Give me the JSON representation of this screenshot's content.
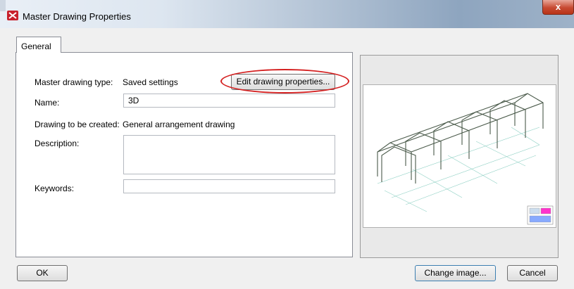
{
  "window": {
    "title": "Master Drawing Properties",
    "close_glyph": "x",
    "icon": "tekla-app-icon"
  },
  "tabs": [
    {
      "label": "General",
      "active": true
    }
  ],
  "form": {
    "master_type_label": "Master drawing type:",
    "master_type_value": "Saved settings",
    "edit_button_label": "Edit drawing properties...",
    "name_label": "Name:",
    "name_value": "3D",
    "drawing_created_label": "Drawing to be created:",
    "drawing_created_value": "General arrangement drawing",
    "description_label": "Description:",
    "description_value": "",
    "keywords_label": "Keywords:",
    "keywords_value": ""
  },
  "preview": {
    "image": "3d-steel-frame-preview"
  },
  "buttons": {
    "ok": "OK",
    "change_image": "Change image...",
    "cancel": "Cancel"
  },
  "colors": {
    "highlight_ellipse": "#d42020",
    "close_button": "#c74a32",
    "structure_lines": "#4a5a4a",
    "grid_lines": "#8ed0c4"
  }
}
